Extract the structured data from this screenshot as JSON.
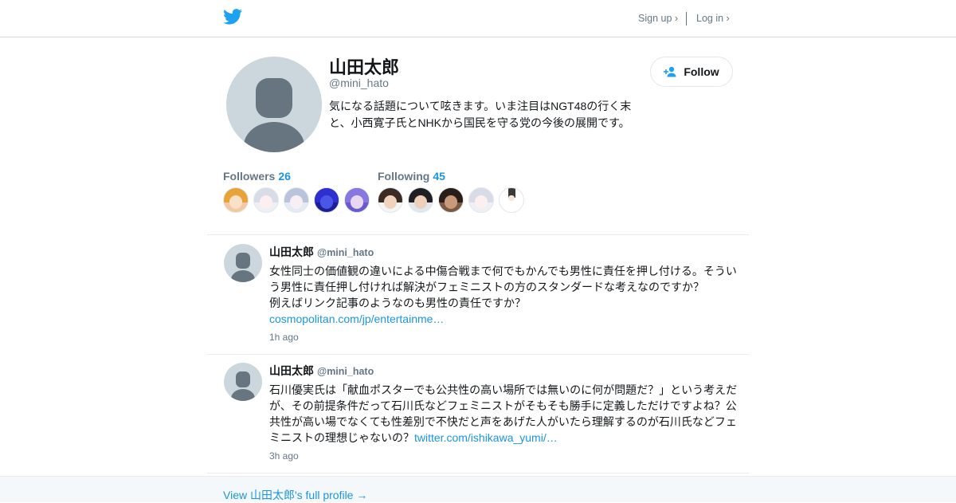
{
  "header": {
    "signup_label": "Sign up ›",
    "login_label": "Log in ›"
  },
  "profile": {
    "name": "山田太郎",
    "handle": "@mini_hato",
    "bio": "気になる話題について呟きます。いま注目はNGT48の行く末と、小西寛子氏とNHKから国民を守る党の今後の展開です。",
    "follow_label": "Follow",
    "followers_label": "Followers",
    "followers_count": "26",
    "following_label": "Following",
    "following_count": "45"
  },
  "tweets": [
    {
      "name": "山田太郎",
      "handle": "@mini_hato",
      "text": "女性同士の価値観の違いによる中傷合戦まで何でもかんでも男性に責任を押し付ける。そういう男性に責任押し付ければ解決がフェミニストの方のスタンダードな考えなのですか？\n例えばリンク記事のようなのも男性の責任ですか？",
      "link": "cosmopolitan.com/jp/entertainme…",
      "time": "1h ago"
    },
    {
      "name": "山田太郎",
      "handle": "@mini_hato",
      "text": "石川優実氏は「献血ポスターでも公共性の高い場所では無いのに何が問題だ？」という考えだが、その前提条件だって石川氏などフェミニストがそもそも勝手に定義しただけですよね？公共性が高い場でなくても性差別で不快だと声をあげた人がいたら理解するのが石川氏などフェミニストの理想じゃないの？",
      "link": "twitter.com/ishikawa_yumi/…",
      "time": "3h ago"
    }
  ],
  "footer": {
    "profile_link": "View 山田太郎's full profile →"
  },
  "colors": {
    "brand": "#1da1f2",
    "link": "#1b95e0",
    "muted": "#657786",
    "avatar_bg": "#ccd6dd",
    "avatar_fg": "#66757f"
  },
  "icons": {
    "logo": "twitter-bird-icon",
    "follow": "add-user-icon",
    "default_avatar": "default-avatar-icon"
  }
}
